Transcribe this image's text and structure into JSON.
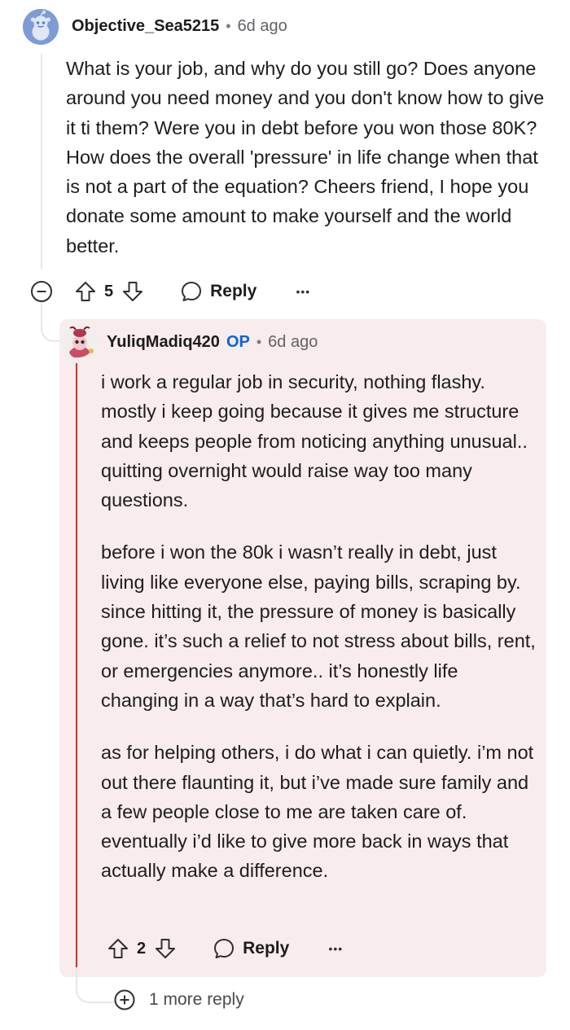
{
  "comment": {
    "author": "Objective_Sea5215",
    "time": "6d ago",
    "avatar_icon": "reddit-snoo-avatar-icon",
    "body": [
      "What is your job, and why do you still go? Does anyone around you need money and you don't know how to give it ti them? Were you in debt before you won those 80K? How does the overall 'pressure' in life change when that is not a part of the equation? Cheers friend, I hope you donate some amount to make yourself and the world better."
    ],
    "votes": "5",
    "reply_label": "Reply",
    "more_label": "•••"
  },
  "reply": {
    "author": "YuliqMadiq420",
    "op_badge": "OP",
    "time": "6d ago",
    "avatar_icon": "cartoon-avatar-icon",
    "paragraphs": [
      "i work a regular job in security, nothing flashy. mostly i keep going because it gives me structure and keeps people from noticing anything unusual.. quitting overnight would raise way too many questions.",
      "before i won the 80k i wasn’t really in debt, just living like everyone else, paying bills, scraping by. since hitting it, the pressure of money is basically gone. it’s such a relief to not stress about bills, rent, or emergencies anymore.. it’s honestly life changing in a way that’s hard to explain.",
      "as for helping others, i do what i can quietly. i’m not out there flaunting it, but i’ve made sure family and a few people close to me are taken care of. eventually i’d like to give more back in ways that actually make a difference."
    ],
    "votes": "2",
    "reply_label": "Reply",
    "more_label": "•••"
  },
  "more_replies": {
    "label": "1 more reply",
    "icon": "plus-circle-icon"
  },
  "colors": {
    "op_badge": "#0a66d8",
    "reply_background": "#f9ecec",
    "reply_accent": "#d3311f",
    "thread_line": "#e5e7e9"
  }
}
